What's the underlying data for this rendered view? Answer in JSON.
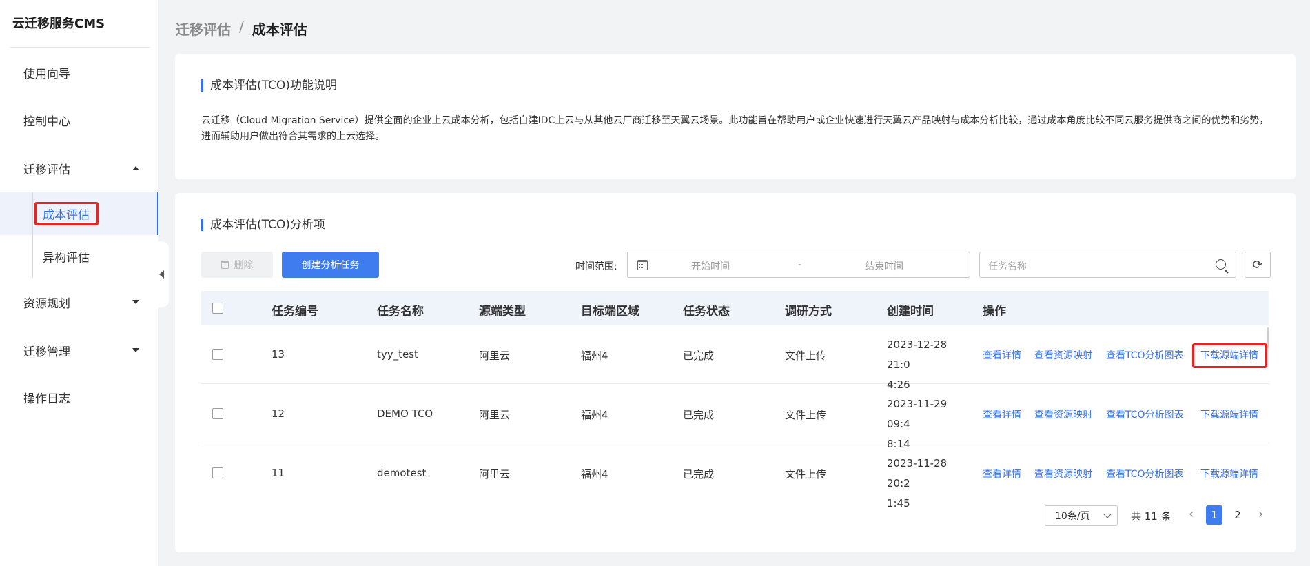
{
  "app": {
    "title": "云迁移服务CMS"
  },
  "sidebar": {
    "items": [
      {
        "label": "使用向导"
      },
      {
        "label": "控制中心"
      },
      {
        "label": "迁移评估"
      },
      {
        "label": "资源规划"
      },
      {
        "label": "迁移管理"
      },
      {
        "label": "操作日志"
      }
    ],
    "sub_items": [
      {
        "label": "成本评估",
        "active": true
      },
      {
        "label": "异构评估",
        "active": false
      }
    ]
  },
  "breadcrumb": {
    "parent": "迁移评估",
    "separator": "/",
    "current": "成本评估"
  },
  "intro": {
    "title": "成本评估(TCO)功能说明",
    "text": "云迁移（Cloud Migration Service）提供全面的企业上云成本分析，包括自建IDC上云与从其他云厂商迁移至天翼云场景。此功能旨在帮助用户或企业快速进行天翼云产品映射与成本分析比较，通过成本角度比较不同云服务提供商之间的优势和劣势，进而辅助用户做出符合其需求的上云选择。"
  },
  "analysis": {
    "title": "成本评估(TCO)分析项",
    "delete_label": "删除",
    "create_label": "创建分析任务",
    "time_range_label": "时间范围:",
    "start_placeholder": "开始时间",
    "range_separator": "-",
    "end_placeholder": "结束时间",
    "search_placeholder": "任务名称"
  },
  "table": {
    "columns": [
      "任务编号",
      "任务名称",
      "源端类型",
      "目标端区域",
      "任务状态",
      "调研方式",
      "创建时间",
      "操作"
    ],
    "rows": [
      {
        "id": "13",
        "name": "tyy_test",
        "source": "阿里云",
        "region": "福州4",
        "status": "已完成",
        "method": "文件上传",
        "created_line1": "2023-12-28 21:0",
        "created_line2": "4:26"
      },
      {
        "id": "12",
        "name": "DEMO TCO",
        "source": "阿里云",
        "region": "福州4",
        "status": "已完成",
        "method": "文件上传",
        "created_line1": "2023-11-29 09:4",
        "created_line2": "8:14"
      },
      {
        "id": "11",
        "name": "demotest",
        "source": "阿里云",
        "region": "福州4",
        "status": "已完成",
        "method": "文件上传",
        "created_line1": "2023-11-28 20:2",
        "created_line2": "1:45"
      }
    ],
    "actions": [
      "查看详情",
      "查看资源映射",
      "查看TCO分析图表",
      "下载源端详情"
    ]
  },
  "pagination": {
    "page_size": "10条/页",
    "total": "共 11 条",
    "pages": [
      "1",
      "2"
    ],
    "current_page": "1"
  },
  "colors": {
    "accent": "#3470e8",
    "highlight": "#e52424"
  }
}
